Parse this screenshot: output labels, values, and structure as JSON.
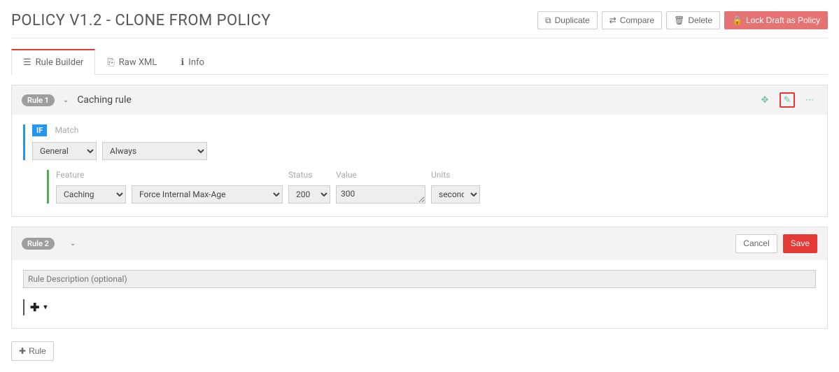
{
  "header": {
    "title": "POLICY V1.2 - CLONE FROM POLICY",
    "duplicate_label": "Duplicate",
    "compare_label": "Compare",
    "delete_label": "Delete",
    "lock_label": "Lock Draft as Policy"
  },
  "tabs": {
    "rule_builder": "Rule Builder",
    "raw_xml": "Raw XML",
    "info": "Info"
  },
  "rule1": {
    "badge": "Rule 1",
    "title": "Caching rule",
    "if_label": "IF",
    "match_label": "Match",
    "match_category": "General",
    "match_condition": "Always",
    "feature_heading": "Feature",
    "status_heading": "Status",
    "value_heading": "Value",
    "units_heading": "Units",
    "feature_category": "Caching",
    "feature_name": "Force Internal Max-Age",
    "status_value": "200",
    "value_value": "300",
    "units_value": "seconds"
  },
  "rule2": {
    "badge": "Rule 2",
    "cancel_label": "Cancel",
    "save_label": "Save",
    "description_placeholder": "Rule Description (optional)"
  },
  "footer": {
    "add_rule_label": "Rule"
  }
}
